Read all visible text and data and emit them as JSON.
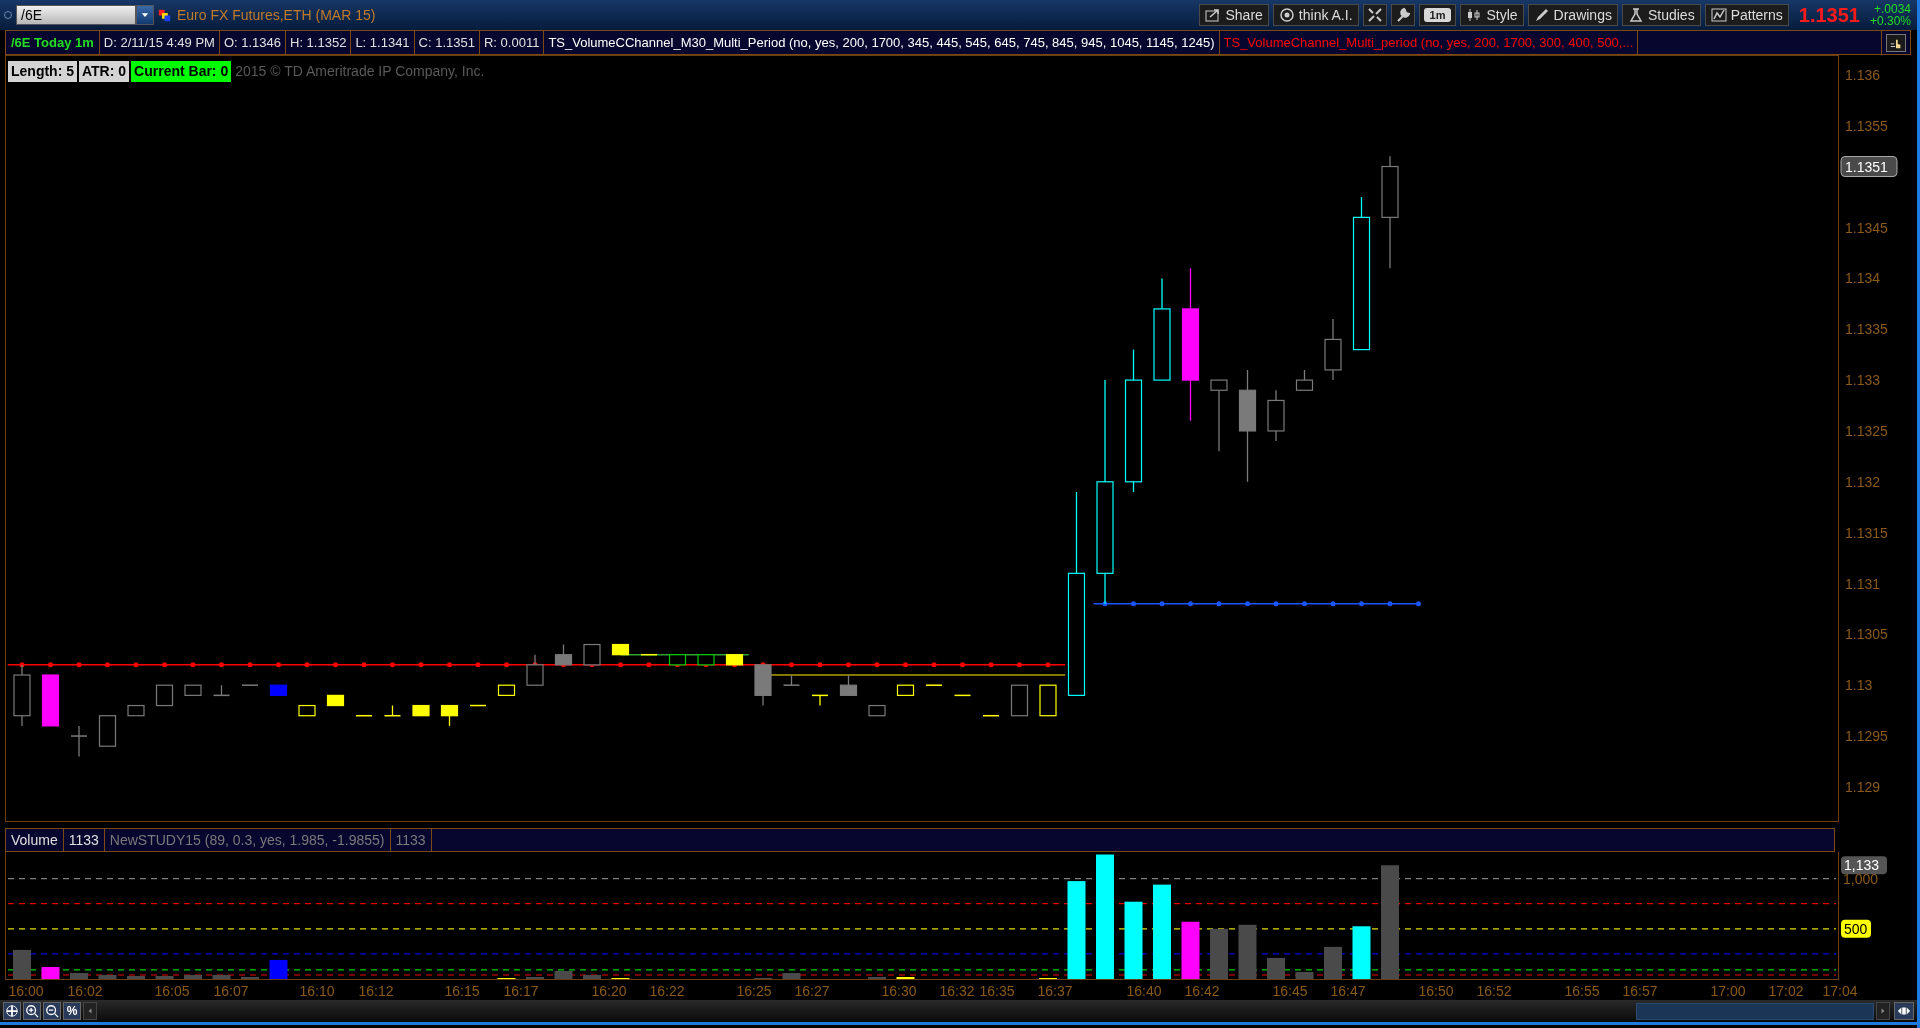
{
  "toolbar": {
    "symbol": "/6E",
    "description": "Euro FX Futures,ETH (MAR 15)",
    "buttons": [
      {
        "kind": "labeled",
        "label": "Share"
      },
      {
        "kind": "labeled",
        "label": "think A.I."
      },
      {
        "kind": "icon"
      },
      {
        "kind": "icon"
      },
      {
        "kind": "chip",
        "label": "1m"
      },
      {
        "kind": "labeled",
        "label": "Style"
      },
      {
        "kind": "labeled",
        "label": "Drawings"
      },
      {
        "kind": "labeled",
        "label": "Studies"
      },
      {
        "kind": "labeled",
        "label": "Patterns"
      }
    ],
    "last_price": "1.1351",
    "change": "+.0034",
    "change_percent": "+0.30%"
  },
  "info_bar": {
    "period": "/6E Today 1m",
    "fields": [
      "D: 2/11/15 4:49 PM",
      "O: 1.1346",
      "H: 1.1352",
      "L: 1.1341",
      "C: 1.1351",
      "R: 0.0011"
    ],
    "studies": [
      {
        "text": "TS_VolumeCChannel_M30_Multi_Period (no, yes, 200, 1700, 345, 445, 545, 645, 745, 845, 945, 1045, 1145, 1245)",
        "color": "#ffffff"
      },
      {
        "text": "TS_VolumeChannel_Multi_period (no, yes, 200, 1700, 300, 400, 500,...",
        "color": "#ff0000"
      }
    ]
  },
  "price_panel": {
    "labels": [
      {
        "text": "Length: 5",
        "color": "#d4d4d4"
      },
      {
        "text": "ATR: 0",
        "color": "#d4d4d4"
      },
      {
        "text": "Current Bar: 0",
        "color": "#00ff00"
      }
    ],
    "copyright": "2015 © TD Ameritrade IP Company, Inc.",
    "price_axis": [
      "1.136",
      "1.1355",
      "1.1345",
      "1.134",
      "1.1335",
      "1.133",
      "1.1325",
      "1.132",
      "1.1315",
      "1.131",
      "1.1305",
      "1.13",
      "1.1295",
      "1.129"
    ],
    "last_price_badge": "1.1351"
  },
  "volume_panel": {
    "header": [
      {
        "text": "Volume",
        "dim": false
      },
      {
        "text": "1133",
        "dim": false
      },
      {
        "text": "NewSTUDY15 (89, 0.3, yes, 1.985, -1.9855)",
        "dim": true
      },
      {
        "text": "1133",
        "dim": true
      }
    ],
    "volume_axis": [
      "1,000"
    ],
    "badges": [
      {
        "text": "1,133",
        "color": "#555555"
      },
      {
        "text": "500",
        "color": "#ffff00"
      }
    ],
    "time_axis": [
      "16:00",
      "16:02",
      "16:05",
      "16:07",
      "16:10",
      "16:12",
      "16:15",
      "16:17",
      "16:20",
      "16:22",
      "16:25",
      "16:27",
      "16:30",
      "16:32",
      "16:35",
      "16:37",
      "16:40",
      "16:42",
      "16:45",
      "16:47",
      "16:50",
      "16:52",
      "16:55",
      "16:57",
      "17:00",
      "17:02",
      "17:04"
    ]
  },
  "bottom_bar": {
    "percent_button": "%"
  }
}
